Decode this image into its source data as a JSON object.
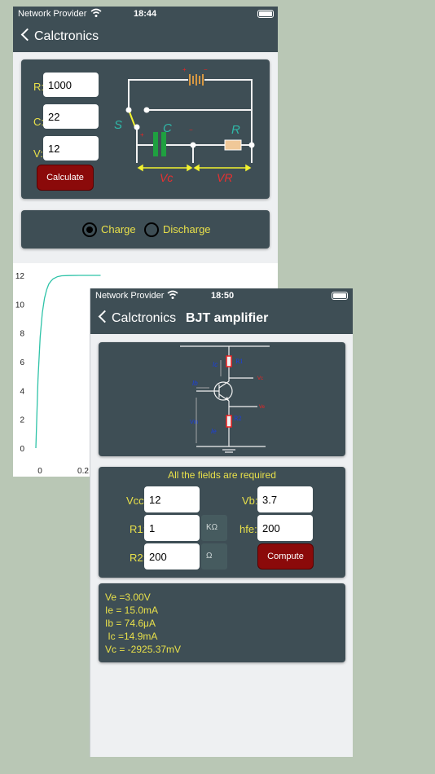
{
  "screen1": {
    "status": {
      "carrier": "Network Provider",
      "time": "18:44"
    },
    "nav": {
      "back_label": "Calctronics"
    },
    "inputs": {
      "r_label": "R:",
      "r_value": "1000",
      "c_label": "C:",
      "c_value": "22",
      "v_label": "V:",
      "v_value": "12"
    },
    "calculate_label": "Calculate",
    "circuit_labels": {
      "s": "S",
      "c": "C",
      "r": "R",
      "vc": "Vc",
      "vr": "VR"
    },
    "mode": {
      "charge_label": "Charge",
      "discharge_label": "Discharge",
      "selected": "Charge"
    },
    "chart_data": {
      "type": "line",
      "x_ticks": [
        "0",
        "0.2"
      ],
      "y_ticks": [
        "0",
        "2",
        "4",
        "6",
        "8",
        "10",
        "12"
      ],
      "ylim": [
        0,
        12
      ],
      "series": [
        {
          "x": [
            0,
            0.01,
            0.02,
            0.03,
            0.04,
            0.05,
            0.06,
            0.07,
            0.08,
            0.1,
            0.12,
            0.15,
            0.2,
            0.3
          ],
          "values": [
            0,
            4.8,
            7.7,
            9.4,
            10.4,
            11.0,
            11.4,
            11.6,
            11.76,
            11.91,
            11.97,
            11.99,
            12.0,
            12.0
          ],
          "color": "#2fc3a8"
        }
      ]
    }
  },
  "screen2": {
    "status": {
      "carrier": "Network Provider",
      "time": "18:50"
    },
    "nav": {
      "back_label": "Calctronics",
      "title": "BJT amplifier"
    },
    "circuit_labels": {
      "r1": "R1",
      "r2": "R2",
      "ic": "Ic",
      "ib": "Ib",
      "ie": "Ie",
      "vin": "Vin"
    },
    "form": {
      "required_note": "All the fields are required",
      "vcc_label": "Vcc:",
      "vcc_value": "12",
      "vb_label": "Vb:",
      "vb_value": "3.7",
      "r1_label": "R1:",
      "r1_value": "1",
      "r1_unit": "KΩ",
      "hfe_label": "hfe:",
      "hfe_value": "200",
      "r2_label": "R2:",
      "r2_value": "200",
      "r2_unit": "Ω",
      "compute_label": "Compute"
    },
    "results": [
      "Ve =3.00V",
      "Ie = 15.0mA",
      "Ib = 74.6μA",
      " Ic =14.9mA",
      "Vc = -2925.37mV"
    ]
  }
}
